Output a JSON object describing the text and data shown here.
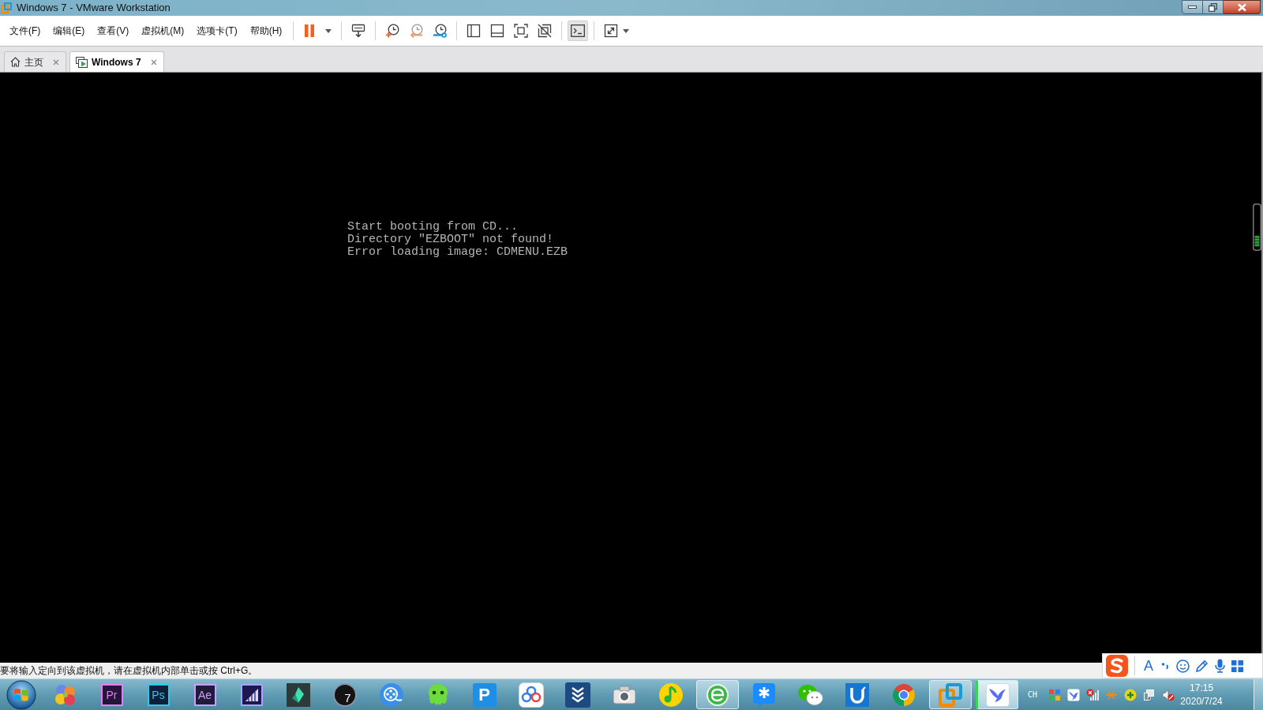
{
  "window": {
    "title": "Windows 7 - VMware Workstation"
  },
  "menu": [
    "文件(F)",
    "编辑(E)",
    "查看(V)",
    "虚拟机(M)",
    "选项卡(T)",
    "帮助(H)"
  ],
  "toolbar": {
    "console_view": {
      "selected": true
    }
  },
  "tabs": [
    {
      "kind": "home",
      "label": "主页",
      "selected": false
    },
    {
      "kind": "vm",
      "label": "Windows 7",
      "selected": true
    }
  ],
  "vm_screen": {
    "lines": [
      "Start booting from CD...",
      "Directory \"EZBOOT\" not found!",
      "Error loading image: CDMENU.EZB"
    ]
  },
  "status_bar": {
    "message": "要将输入定向到该虚拟机，请在虚拟机内部单击或按 Ctrl+G。"
  },
  "ime_toolbar": {
    "mode": "A"
  },
  "taskbar": {
    "apps": [
      {
        "kind": "balls",
        "open": false,
        "highlighted": false
      },
      {
        "kind": "letter_tile",
        "label": "Pr",
        "color": "#e77cf5",
        "open": false,
        "highlighted": false
      },
      {
        "kind": "letter_tile",
        "label": "Ps",
        "color": "#31c5f0",
        "open": false,
        "highlighted": false
      },
      {
        "kind": "letter_tile",
        "label": "Ae",
        "color": "#c9a0ff",
        "open": false,
        "highlighted": false
      },
      {
        "kind": "stairs",
        "open": false,
        "highlighted": false
      },
      {
        "kind": "kite",
        "open": false,
        "highlighted": false
      },
      {
        "kind": "disc",
        "label": "7",
        "open": false,
        "highlighted": false
      },
      {
        "kind": "reel",
        "open": false,
        "highlighted": false
      },
      {
        "kind": "octopus",
        "open": false,
        "highlighted": false
      },
      {
        "kind": "letter_square",
        "label": "P",
        "open": false,
        "highlighted": false
      },
      {
        "kind": "cloud",
        "open": false,
        "highlighted": false
      },
      {
        "kind": "chevrons",
        "open": false,
        "highlighted": false
      },
      {
        "kind": "camera",
        "open": false,
        "highlighted": false
      },
      {
        "kind": "note",
        "open": false,
        "highlighted": false
      },
      {
        "kind": "globe",
        "open": true,
        "highlighted": false
      },
      {
        "kind": "asterisk",
        "open": false,
        "highlighted": false
      },
      {
        "kind": "chat",
        "open": false,
        "highlighted": false
      },
      {
        "kind": "u_tile",
        "open": false,
        "highlighted": false
      },
      {
        "kind": "tricolor",
        "open": false,
        "highlighted": false
      },
      {
        "kind": "squares",
        "open": true,
        "highlighted": false
      },
      {
        "kind": "bird",
        "open": true,
        "highlighted": true
      }
    ]
  },
  "tray": {
    "language": "CH",
    "time": "17:15",
    "date": "2020/7/24"
  }
}
